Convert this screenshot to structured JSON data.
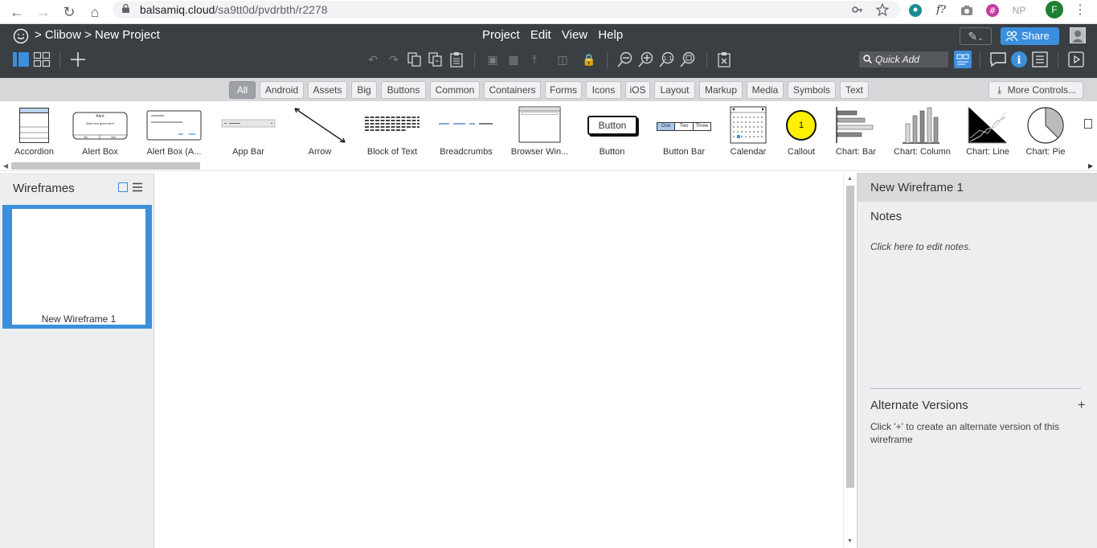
{
  "browser": {
    "url_host": "balsamiq.cloud",
    "url_path": "/sa9tt0d/pvdrbth/r2278",
    "profile_initial": "F",
    "ext_np": "NP",
    "ext_font": "f?"
  },
  "app": {
    "breadcrumb": "> Clibow > New Project",
    "menu": [
      "Project",
      "Edit",
      "View",
      "Help"
    ],
    "share_label": "Share",
    "quick_add_placeholder": "Quick Add",
    "accent_color": "#3b8fdc"
  },
  "filters": {
    "tabs": [
      "All",
      "Android",
      "Assets",
      "Big",
      "Buttons",
      "Common",
      "Containers",
      "Forms",
      "Icons",
      "iOS",
      "Layout",
      "Markup",
      "Media",
      "Symbols",
      "Text"
    ],
    "selected": "All",
    "more_controls": "More Controls..."
  },
  "library": {
    "items": [
      "Accordion",
      "Alert Box",
      "Alert Box (A...",
      "App Bar",
      "Arrow",
      "Block of Text",
      "Breadcrumbs",
      "Browser Win...",
      "Button",
      "Button Bar",
      "Calendar",
      "Callout",
      "Chart: Bar",
      "Chart: Column",
      "Chart: Line",
      "Chart: Pie"
    ],
    "button_text": "Button",
    "button_bar": [
      "One",
      "Two",
      "Three"
    ],
    "callout_number": "1",
    "alert_title": "Alert",
    "alert_body": "Alert text goes here",
    "alert_buttons": [
      "No",
      "Yes"
    ]
  },
  "wireframes": {
    "title": "Wireframes",
    "items": [
      {
        "label": "New Wireframe 1",
        "selected": true
      }
    ]
  },
  "inspector": {
    "title": "New Wireframe 1",
    "notes_heading": "Notes",
    "notes_placeholder": "Click here to edit notes.",
    "alt_heading": "Alternate Versions",
    "alt_add": "+",
    "alt_text": "Click '+' to create an alternate version of this wireframe"
  }
}
